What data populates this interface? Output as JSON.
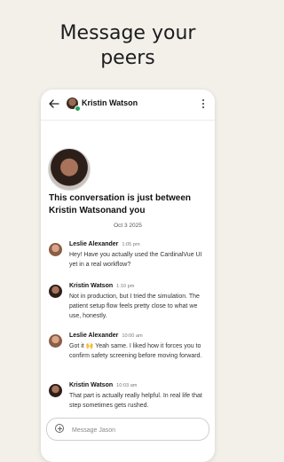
{
  "headline": {
    "line1": "Message your",
    "line2": "peers"
  },
  "header": {
    "name": "Kristin Watson",
    "online": true
  },
  "conversation": {
    "intro_line1": "This conversation is just between",
    "intro_line2": "Kristin Watsonand you",
    "date": "Oct 3 2025"
  },
  "messages": [
    {
      "sender": "Leslie Alexander",
      "time": "1:05 pm",
      "text": "Hey! Have you actually used the CardinalVue UI yet in a real workflow?"
    },
    {
      "sender": "Kristin Watson",
      "time": "1:10 pm",
      "text": "Not in production, but I tried the simulation. The patient setup flow feels pretty close to what we use, honestly."
    },
    {
      "sender": "Leslie Alexander",
      "time": "10:00 am",
      "text": "Got it 🙌 Yeah same. I liked how it forces you to confirm safety screening before moving forward."
    },
    {
      "sender": "Kristin Watson",
      "time": "10:03 am",
      "text": "That part is actually really helpful. In real life that step sometimes gets rushed."
    }
  ],
  "composer": {
    "placeholder": "Message Jason",
    "value": ""
  },
  "icons": {
    "back": "arrow-left-icon",
    "menu": "more-vertical-icon",
    "attach": "plus-circle-icon"
  },
  "colors": {
    "background": "#f3f0ea",
    "online": "#22a35a"
  }
}
